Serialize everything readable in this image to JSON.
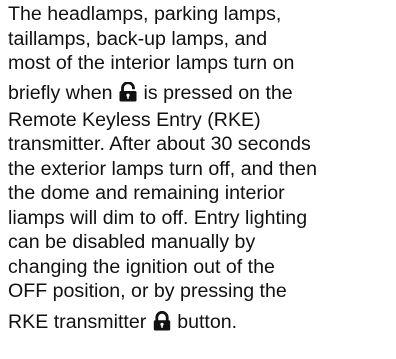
{
  "paragraph": {
    "lines": [
      "The headlamps, parking lamps,",
      "taillamps, back-up lamps, and",
      "most of the interior lamps turn on",
      "briefly when",
      "is pressed on the",
      "Remote Keyless Entry (RKE)",
      "transmitter. After about 30 seconds",
      "the exterior lamps turn off, and then",
      "the dome and remaining interior",
      "liamps will dim to off. Entry lighting",
      "can be disabled manually by",
      "changing the ignition out of the",
      "OFF position, or by pressing the",
      "RKE transmitter",
      "button."
    ],
    "icons": {
      "unlock": "unlock-icon",
      "lock": "lock-icon"
    }
  }
}
